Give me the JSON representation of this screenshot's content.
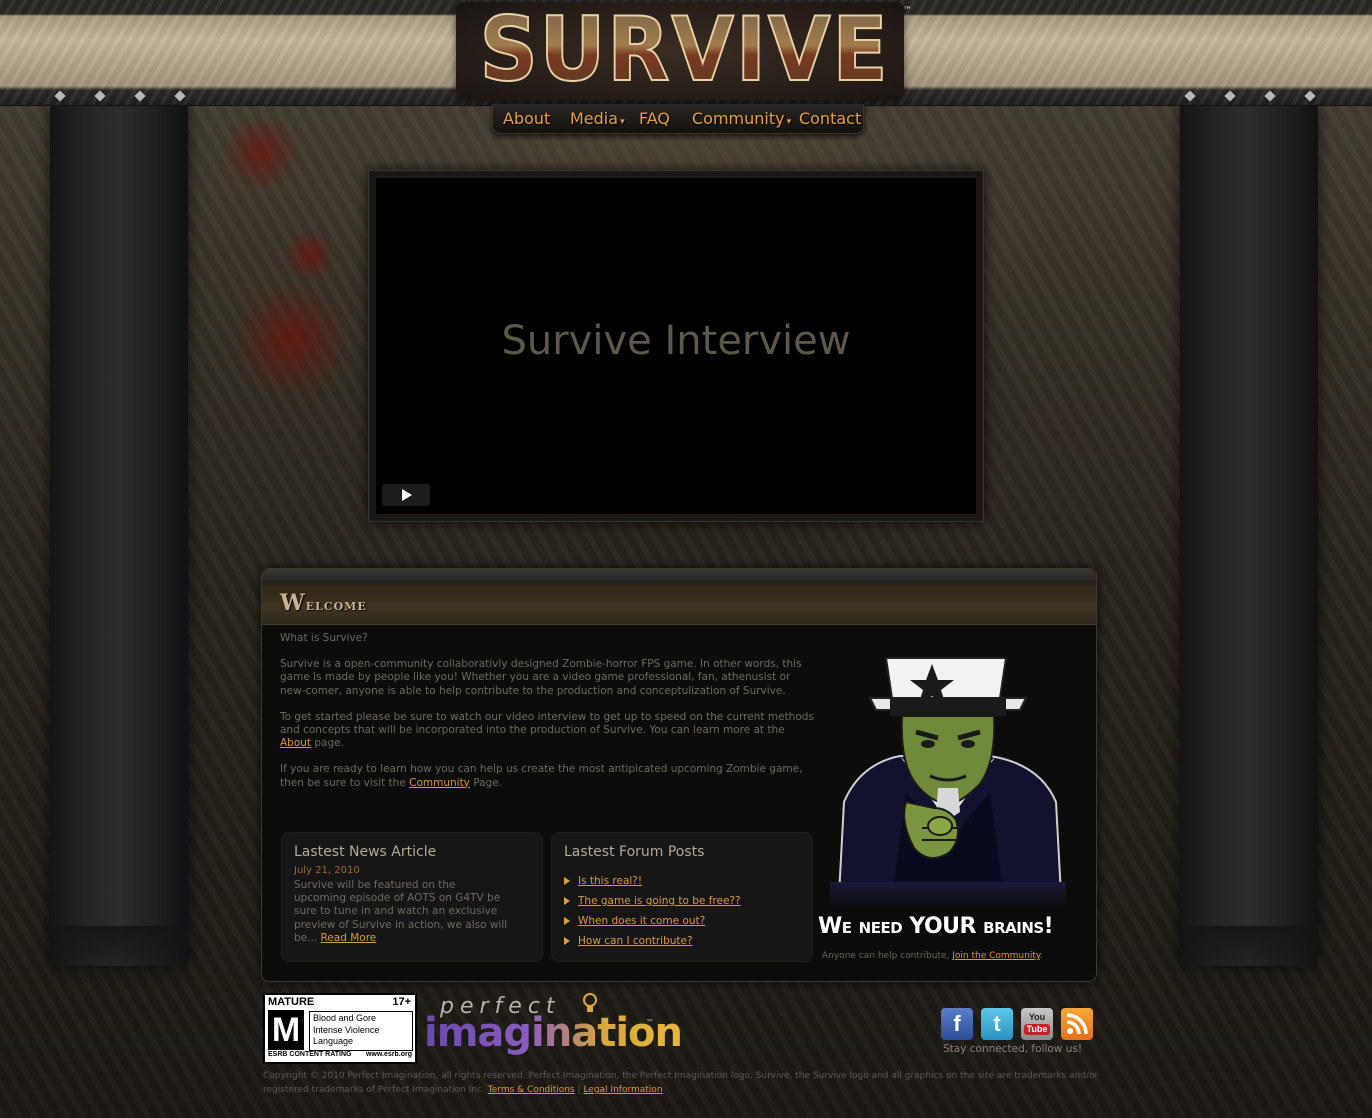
{
  "header": {
    "logo_text": "SURVIVE",
    "logo_tm": "™"
  },
  "nav": {
    "items": [
      {
        "label": "About",
        "has_dropdown": false
      },
      {
        "label": "Media",
        "has_dropdown": true
      },
      {
        "label": "FAQ",
        "has_dropdown": false
      },
      {
        "label": "Community",
        "has_dropdown": true
      },
      {
        "label": "Contact",
        "has_dropdown": false
      }
    ],
    "dropdown_glyph": "▾"
  },
  "video": {
    "title": "Survive Interview",
    "play_icon": "play-icon"
  },
  "welcome": {
    "title": "Welcome",
    "question": "What is Survive?",
    "para1": "Survive is a open-community collaborativly designed Zombie-horror FPS game. In other words, this game is made by people like you! Whether you are a video game professional, fan, athenusist or new-comer, anyone is able to help contribute to the production and conceptulization of Survive.",
    "para2_before": "To get started please be sure to watch our video interview to get up to speed on the current methods and concepts that will be incorporated into the production of Survive. You can learn more at the ",
    "para2_link": "About",
    "para2_after": " page.",
    "para3_before": "If you are ready to learn how you can help us create the most antipicated upcoming Zombie game, then be sure to visit the ",
    "para3_link": "Community",
    "para3_after": " Page."
  },
  "news": {
    "title": "Lastest News Article",
    "date": "July 21, 2010",
    "text": "Survive will be featured on the upcoming episode of AOTS on G4TV be sure to tune in and watch an exclusive preview of Survive in action, we also will be... ",
    "read_more": "Read More"
  },
  "forum": {
    "title": "Lastest Forum Posts",
    "posts": [
      "Is this real?!",
      "The game is going to be free??",
      "When does it come out?",
      "How can I contribute?"
    ]
  },
  "poster": {
    "headline": "We need YOUR brains!",
    "sub_before": "Anyone can help contribute, ",
    "sub_link": "Join the Community",
    "sub_after": "."
  },
  "footer": {
    "esrb": {
      "rating": "MATURE",
      "age": "17+",
      "letter": "M",
      "descriptors": [
        "Blood and Gore",
        "Intense Violence",
        "Language"
      ],
      "content_rating": "ESRB CONTENT RATING",
      "url": "www.esrb.org"
    },
    "publisher": {
      "top": "perfect",
      "bottom": "imagination",
      "tm": "™"
    },
    "social": {
      "facebook": "f",
      "twitter": "t",
      "youtube_top": "You",
      "youtube_bottom": "Tube",
      "rss_icon": "rss-icon"
    },
    "stay_connected": "Stay connected, follow us!",
    "copyright": "Copyright © 2010 Perfect Imagination, all rights reserved. Perfect Imagination, the Perfect Imagination logo, Survive, the Survive logo and all graphics on the site are trademarks and/or registered trademarks of Perfect Imagination Inc. ",
    "terms": "Terms & Conditions",
    "separator": " | ",
    "legal": "Legal Information"
  }
}
